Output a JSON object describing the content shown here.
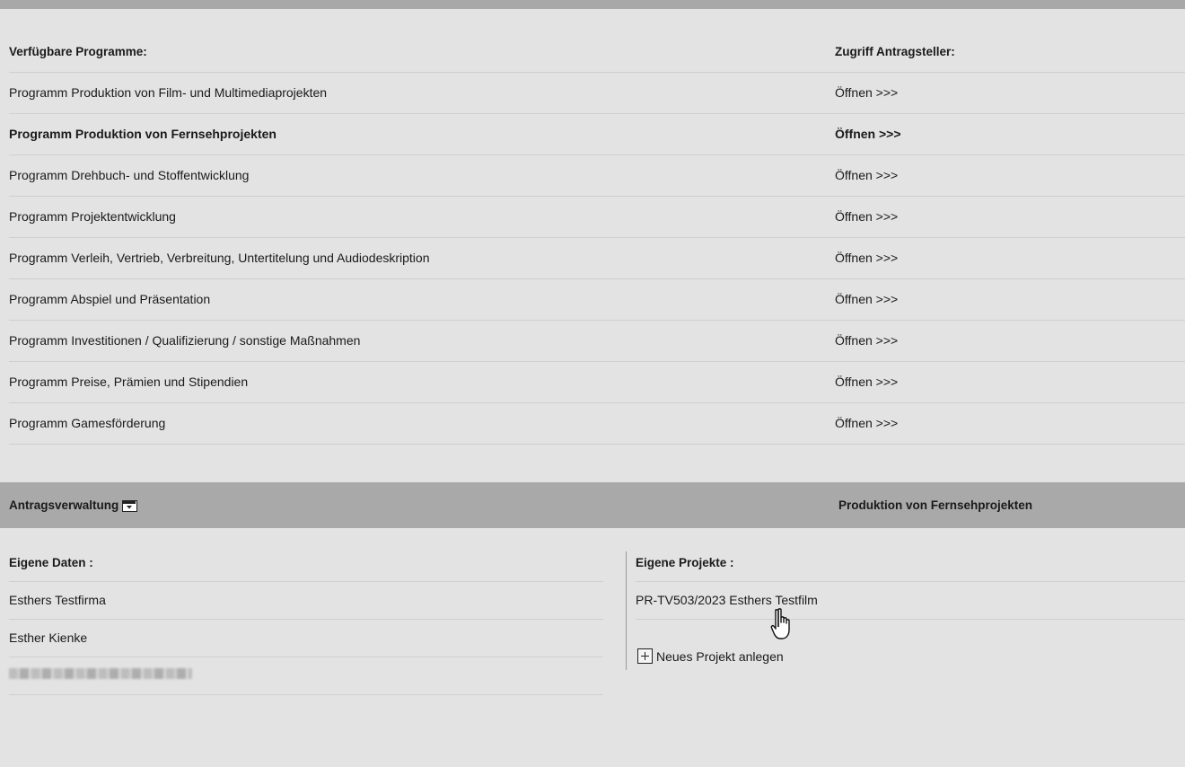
{
  "programs": {
    "header": {
      "name": "Verfügbare Programme:",
      "action": "Zugriff Antragsteller:"
    },
    "rows": [
      {
        "name": "Programm Produktion von Film- und Multimediaprojekten",
        "action": "Öffnen >>>"
      },
      {
        "name": "Programm Produktion von Fernsehprojekten",
        "action": "Öffnen >>>",
        "selected": true
      },
      {
        "name": "Programm Drehbuch- und Stoffentwicklung",
        "action": "Öffnen >>>"
      },
      {
        "name": "Programm Projektentwicklung",
        "action": "Öffnen >>>"
      },
      {
        "name": "Programm Verleih, Vertrieb, Verbreitung, Untertitelung und Audiodeskription",
        "action": "Öffnen >>>"
      },
      {
        "name": "Programm Abspiel und Präsentation",
        "action": "Öffnen >>>"
      },
      {
        "name": "Programm Investitionen / Qualifizierung / sonstige Maßnahmen",
        "action": "Öffnen >>>"
      },
      {
        "name": "Programm Preise, Prämien und Stipendien",
        "action": "Öffnen >>>"
      },
      {
        "name": "Programm Gamesförderung",
        "action": "Öffnen >>>"
      }
    ]
  },
  "admin": {
    "title": "Antragsverwaltung",
    "toggle_icon": "collapse-toggle-icon",
    "selected_program": "Produktion von Fernsehprojekten"
  },
  "own_data": {
    "header": "Eigene Daten :",
    "items": [
      "Esthers Testfirma",
      "Esther Kienke"
    ]
  },
  "own_projects": {
    "header": "Eigene Projekte :",
    "items": [
      "PR-TV503/2023 Esthers Testfilm"
    ],
    "new_project_label": "Neues Projekt anlegen",
    "new_project_icon": "plus-box-icon"
  }
}
